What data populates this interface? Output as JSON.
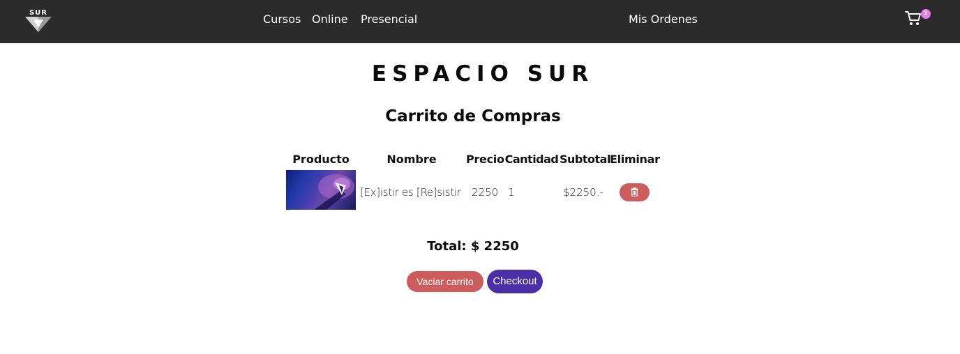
{
  "navbar": {
    "logo_text": "SUR",
    "links": {
      "cursos": "Cursos",
      "online": "Online",
      "presencial": "Presencial",
      "ordenes": "Mis Ordenes"
    },
    "cart": {
      "icon": "shopping-cart-icon",
      "badge_count": "1",
      "badge_color": "#e879e8"
    },
    "background": "#2b2b2b"
  },
  "page": {
    "brand": "ESPACIO SUR",
    "title": "Carrito de Compras"
  },
  "table": {
    "headers": {
      "producto": "Producto",
      "nombre": "Nombre",
      "precio": "Precio",
      "cantidad": "Cantidad",
      "subtotal": "Subtotal",
      "eliminar": "Eliminar"
    },
    "rows": [
      {
        "nombre": "[Ex]istir es [Re]sistir",
        "precio": "2250",
        "cantidad": "1",
        "subtotal": "$2250.-",
        "delete_icon": "trash-icon"
      }
    ]
  },
  "summary": {
    "total": "Total: $ 2250"
  },
  "actions": {
    "vaciar": "Vaciar carrito",
    "checkout": "Checkout"
  },
  "colors": {
    "danger": "#cd5c5c",
    "primary": "#4a2fa8"
  }
}
